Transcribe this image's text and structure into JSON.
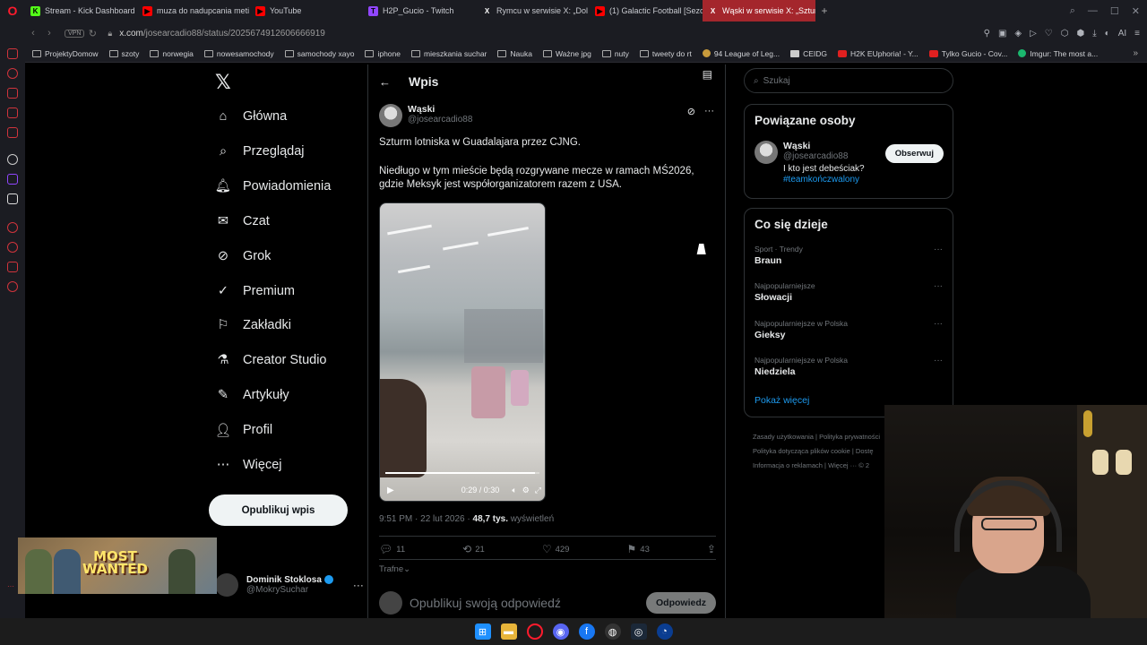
{
  "browser": {
    "tabs": [
      {
        "label": "Stream - Kick Dashboard",
        "color": "#53fc18",
        "glyph": "K"
      },
      {
        "label": "muza do nadupcania meti",
        "color": "#ff0000",
        "glyph": "▶"
      },
      {
        "label": "YouTube",
        "color": "#ff0000",
        "glyph": "▶"
      },
      {
        "label": "H2P_Gucio - Twitch",
        "color": "#9146ff",
        "glyph": "T"
      },
      {
        "label": "Rymcu w serwisie X: „Dol",
        "color": "#ffffff",
        "glyph": "X"
      },
      {
        "label": "(1) Galactic Football [Sezo",
        "color": "#ff0000",
        "glyph": "▶"
      },
      {
        "label": "Wąski w serwisie X: „Sztur",
        "color": "#ffffff",
        "glyph": "X"
      }
    ],
    "active_tab_index": 6,
    "new_tab": "+",
    "vpn_label": "VPN",
    "url_host": "x.com",
    "url_path": "/josearcadio88/status/2025674912606666919",
    "bookmarks": [
      {
        "label": "ProjektyDomow",
        "icon": "folder-icon"
      },
      {
        "label": "szoty",
        "icon": "folder-icon"
      },
      {
        "label": "norwegia",
        "icon": "folder-icon"
      },
      {
        "label": "nowesamochody",
        "icon": "folder-icon"
      },
      {
        "label": "samochody xayo",
        "icon": "folder-icon"
      },
      {
        "label": "iphone",
        "icon": "folder-icon"
      },
      {
        "label": "mieszkania suchar",
        "icon": "folder-icon"
      },
      {
        "label": "Nauka",
        "icon": "folder-icon"
      },
      {
        "label": "Ważne jpg",
        "icon": "folder-icon"
      },
      {
        "label": "nuty",
        "icon": "folder-icon"
      },
      {
        "label": "tweety do rt",
        "icon": "folder-icon"
      },
      {
        "label": "94 League of Leg...",
        "icon": "lol-icon"
      },
      {
        "label": "CEIDG",
        "icon": "ceidg-icon"
      },
      {
        "label": "H2K EUphoria! - Y...",
        "icon": "youtube-icon"
      },
      {
        "label": "Tylko Gucio - Cov...",
        "icon": "youtube-icon"
      },
      {
        "label": "Imgur: The most a...",
        "icon": "imgur-icon"
      }
    ]
  },
  "x": {
    "nav": [
      {
        "label": "Główna",
        "icon": "home-icon"
      },
      {
        "label": "Przeglądaj",
        "icon": "search-icon"
      },
      {
        "label": "Powiadomienia",
        "icon": "bell-icon"
      },
      {
        "label": "Czat",
        "icon": "mail-icon"
      },
      {
        "label": "Grok",
        "icon": "grok-icon"
      },
      {
        "label": "Premium",
        "icon": "premium-icon"
      },
      {
        "label": "Zakładki",
        "icon": "bookmark-icon"
      },
      {
        "label": "Creator Studio",
        "icon": "flask-icon"
      },
      {
        "label": "Artykuły",
        "icon": "article-icon"
      },
      {
        "label": "Profil",
        "icon": "person-icon"
      },
      {
        "label": "Więcej",
        "icon": "more-circle-icon"
      }
    ],
    "post_button": "Opublikuj wpis",
    "me": {
      "name": "Dominik Stoklosa",
      "handle": "@MokrySuchar"
    },
    "header_title": "Wpis",
    "tweet": {
      "author_name": "Wąski",
      "author_handle": "@josearcadio88",
      "text_1": "Szturm lotniska w Guadalajara przez CJNG.",
      "text_2": "Niedługo w tym mieście będą rozgrywane mecze w ramach MŚ2026, gdzie Meksyk jest współorganizatorem razem z USA.",
      "video_time": "0:29 / 0:30",
      "video_progress": 0.97,
      "time": "9:51 PM · 22 lut 2026 · ",
      "views_count": "48,7 tys.",
      "views_label": " wyświetleń",
      "replies": "11",
      "reposts": "21",
      "likes": "429",
      "bookmarks": "43",
      "sort_label": "Trafne",
      "reply_placeholder": "Opublikuj swoją odpowiedź",
      "reply_button": "Odpowiedz"
    },
    "search_placeholder": "Szukaj",
    "related": {
      "title": "Powiązane osoby",
      "name": "Wąski",
      "handle": "@josearcadio88",
      "bio": "I kto jest debeściak?",
      "tag": "#teamkończwalony",
      "follow": "Obserwuj"
    },
    "trends": {
      "title": "Co się dzieje",
      "items": [
        {
          "context": "Sport · Trendy",
          "topic": "Braun"
        },
        {
          "context": "Najpopularniejsze",
          "topic": "Słowacji"
        },
        {
          "context": "Najpopularniejsze w Polska",
          "topic": "Gieksy"
        },
        {
          "context": "Najpopularniejsze w Polska",
          "topic": "Niedziela"
        }
      ],
      "show_more": "Pokaż więcej"
    },
    "footer": {
      "line1": "Zasady użytkowania  |  Polityka prywatności",
      "line2": "Polityka dotycząca plików cookie  |  Dostę",
      "line3": "Informacja o reklamach  |  Więcej ···  © 2"
    }
  },
  "overlay": {
    "game_title_1": "MOST",
    "game_title_2": "WANTED"
  },
  "colors": {
    "accent": "#1d9bf0",
    "opera_red": "#ff1b2d",
    "active_tab": "#a4262c"
  }
}
